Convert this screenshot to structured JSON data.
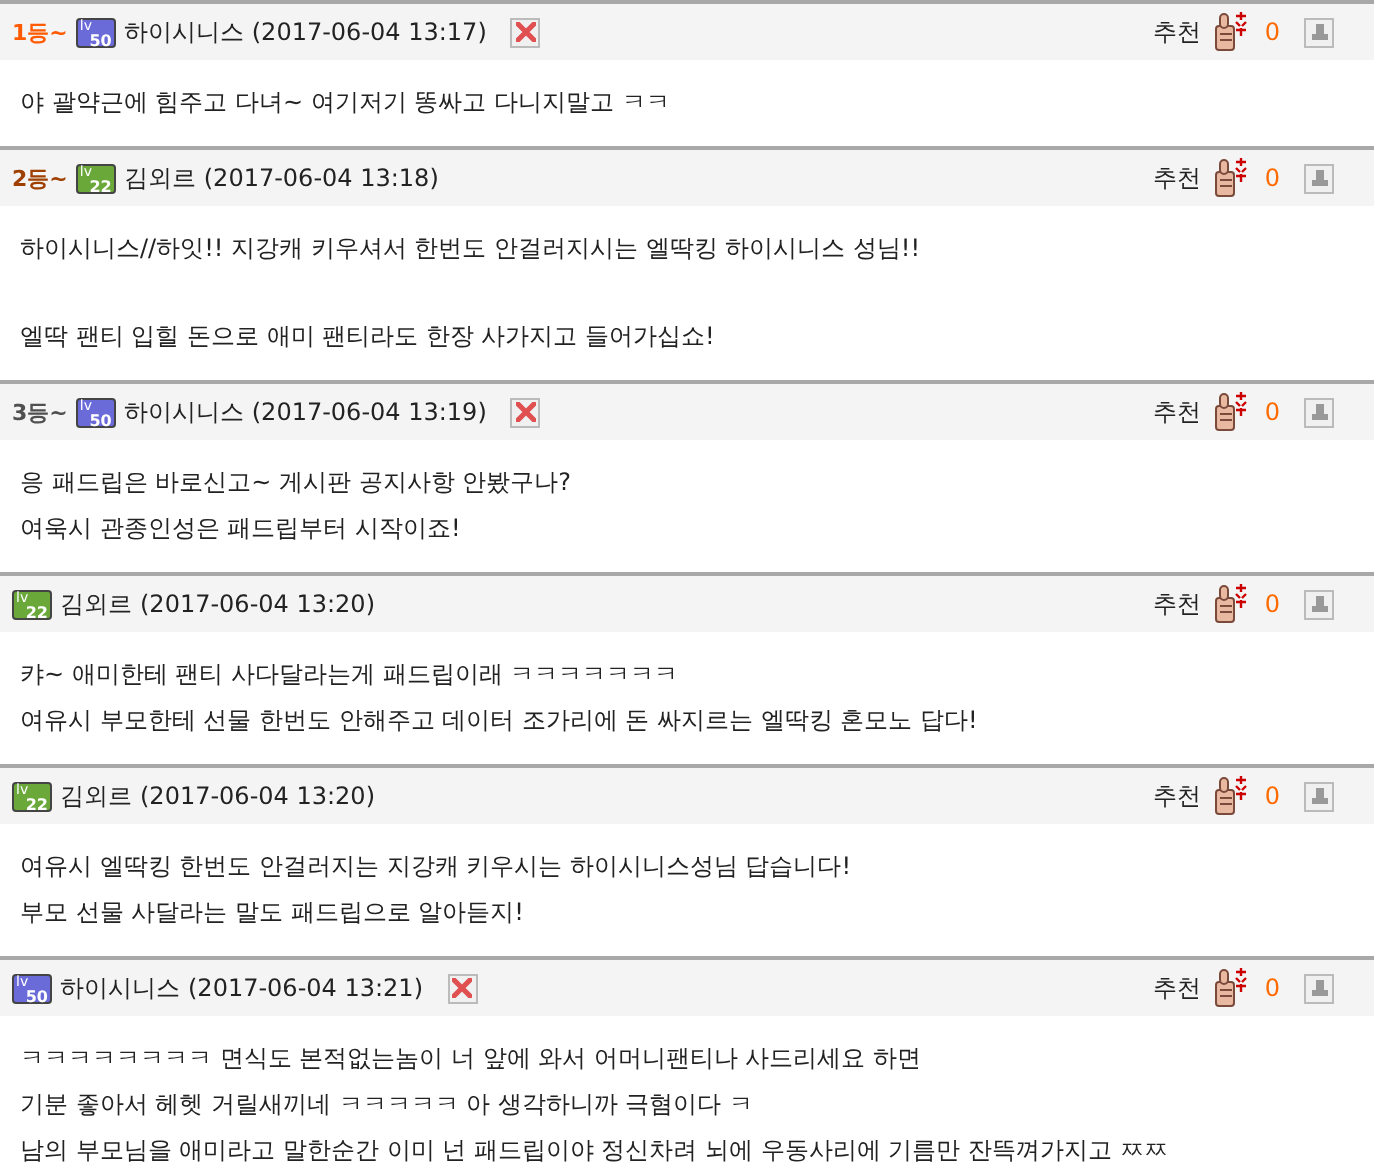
{
  "comments": [
    {
      "rank": {
        "text": "1등~",
        "color": "#ff5a00"
      },
      "badge": {
        "lv": "lv",
        "number": "50",
        "color": "#6a6ad8"
      },
      "author": "하이시니스",
      "date": "(2017-06-04 13:17)",
      "deletable": true,
      "recommend_label": "추천",
      "recommend_count": "0",
      "paragraphs": [
        [
          "야 괄약근에 힘주고 다녀~ 여기저기 똥싸고 다니지말고 ㅋㅋ"
        ]
      ]
    },
    {
      "rank": {
        "text": "2등~",
        "color": "#a04000"
      },
      "badge": {
        "lv": "lv",
        "number": "22",
        "color": "#6aa83a"
      },
      "author": "김외르",
      "date": "(2017-06-04 13:18)",
      "deletable": false,
      "recommend_label": "추천",
      "recommend_count": "0",
      "paragraphs": [
        [
          "하이시니스//하잇!! 지강캐 키우셔서 한번도 안걸러지시는 엘딱킹 하이시니스 성님!!"
        ],
        [
          "엘딱 팬티 입힐 돈으로 애미 팬티라도 한장 사가지고 들어가십쇼!"
        ]
      ]
    },
    {
      "rank": {
        "text": "3등~",
        "color": "#505050"
      },
      "badge": {
        "lv": "lv",
        "number": "50",
        "color": "#6a6ad8"
      },
      "author": "하이시니스",
      "date": "(2017-06-04 13:19)",
      "deletable": true,
      "recommend_label": "추천",
      "recommend_count": "0",
      "paragraphs": [
        [
          "응 패드립은 바로신고~ 게시판 공지사항 안봤구나?",
          "여욱시 관종인성은 패드립부터 시작이죠!"
        ]
      ]
    },
    {
      "badge": {
        "lv": "lv",
        "number": "22",
        "color": "#6aa83a"
      },
      "author": "김외르",
      "date": "(2017-06-04 13:20)",
      "deletable": false,
      "recommend_label": "추천",
      "recommend_count": "0",
      "paragraphs": [
        [
          "캬~ 애미한테 팬티 사다달라는게 패드립이래 ㅋㅋㅋㅋㅋㅋㅋ",
          "여유시 부모한테 선물 한번도 안해주고 데이터 조가리에 돈 싸지르는 엘딱킹 혼모노 답다!"
        ]
      ]
    },
    {
      "badge": {
        "lv": "lv",
        "number": "22",
        "color": "#6aa83a"
      },
      "author": "김외르",
      "date": "(2017-06-04 13:20)",
      "deletable": false,
      "recommend_label": "추천",
      "recommend_count": "0",
      "paragraphs": [
        [
          "여유시 엘딱킹 한번도 안걸러지는 지강캐 키우시는 하이시니스성님 답습니다!",
          "부모 선물 사달라는 말도 패드립으로 알아듣지!"
        ]
      ]
    },
    {
      "badge": {
        "lv": "lv",
        "number": "50",
        "color": "#6a6ad8"
      },
      "author": "하이시니스",
      "date": "(2017-06-04 13:21)",
      "deletable": true,
      "recommend_label": "추천",
      "recommend_count": "0",
      "paragraphs": [
        [
          "ㅋㅋㅋㅋㅋㅋㅋㅋ 면식도 본적없는놈이 너 앞에 와서 어머니팬티나 사드리세요 하면",
          "기분 좋아서 헤헷 거릴새끼네 ㅋㅋㅋㅋㅋ 아 생각하니까 극혐이다 ㅋ",
          "남의 부모님을 애미라고 말한순간 이미 넌 패드립이야 정신차려 뇌에 우동사리에 기름만 잔뜩껴가지고 ㅉㅉ"
        ]
      ]
    }
  ]
}
